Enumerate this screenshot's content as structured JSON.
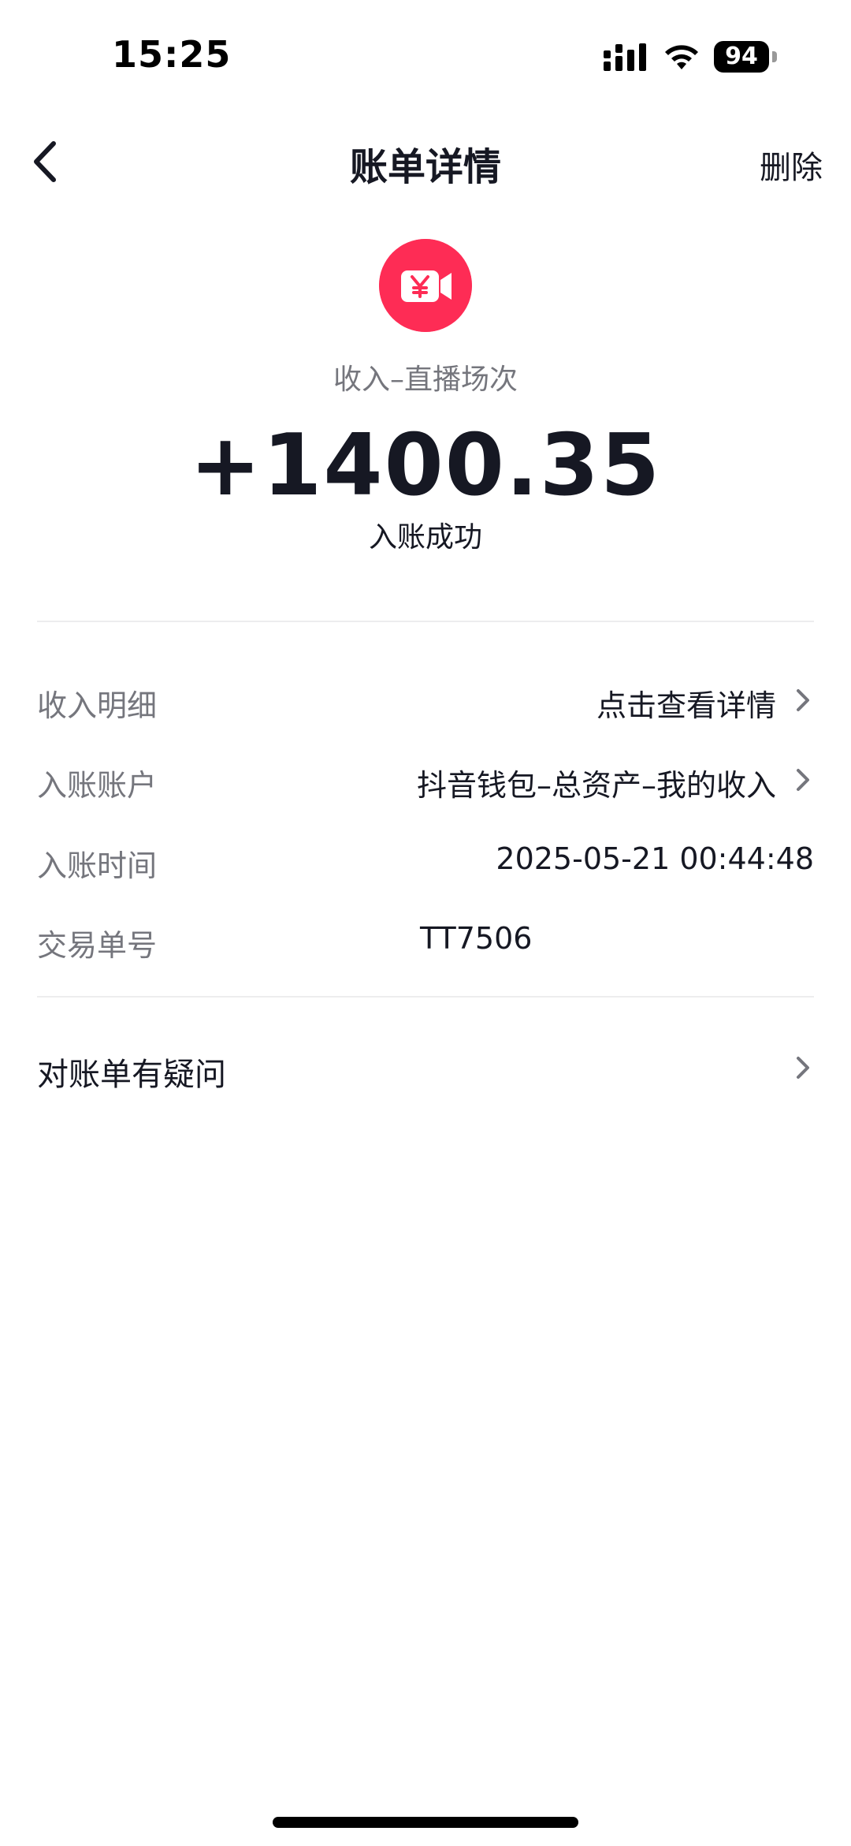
{
  "status_bar": {
    "time": "15:25",
    "battery": "94"
  },
  "nav": {
    "title": "账单详情",
    "delete_label": "删除"
  },
  "header": {
    "icon": "yuan-video-icon",
    "category": "收入–直播场次",
    "amount": "+1400.35",
    "status": "入账成功"
  },
  "details": {
    "income_detail": {
      "label": "收入明细",
      "value": "点击查看详情"
    },
    "account": {
      "label": "入账账户",
      "value": "抖音钱包–总资产–我的收入"
    },
    "time": {
      "label": "入账时间",
      "value": "2025-05-21 00:44:48"
    },
    "order": {
      "label": "交易单号",
      "value": "TT7506"
    }
  },
  "help": {
    "label": "对账单有疑问"
  },
  "colors": {
    "accent": "#fe2c55",
    "text_primary": "#161823",
    "text_secondary": "#75767d",
    "divider": "#ededee"
  }
}
